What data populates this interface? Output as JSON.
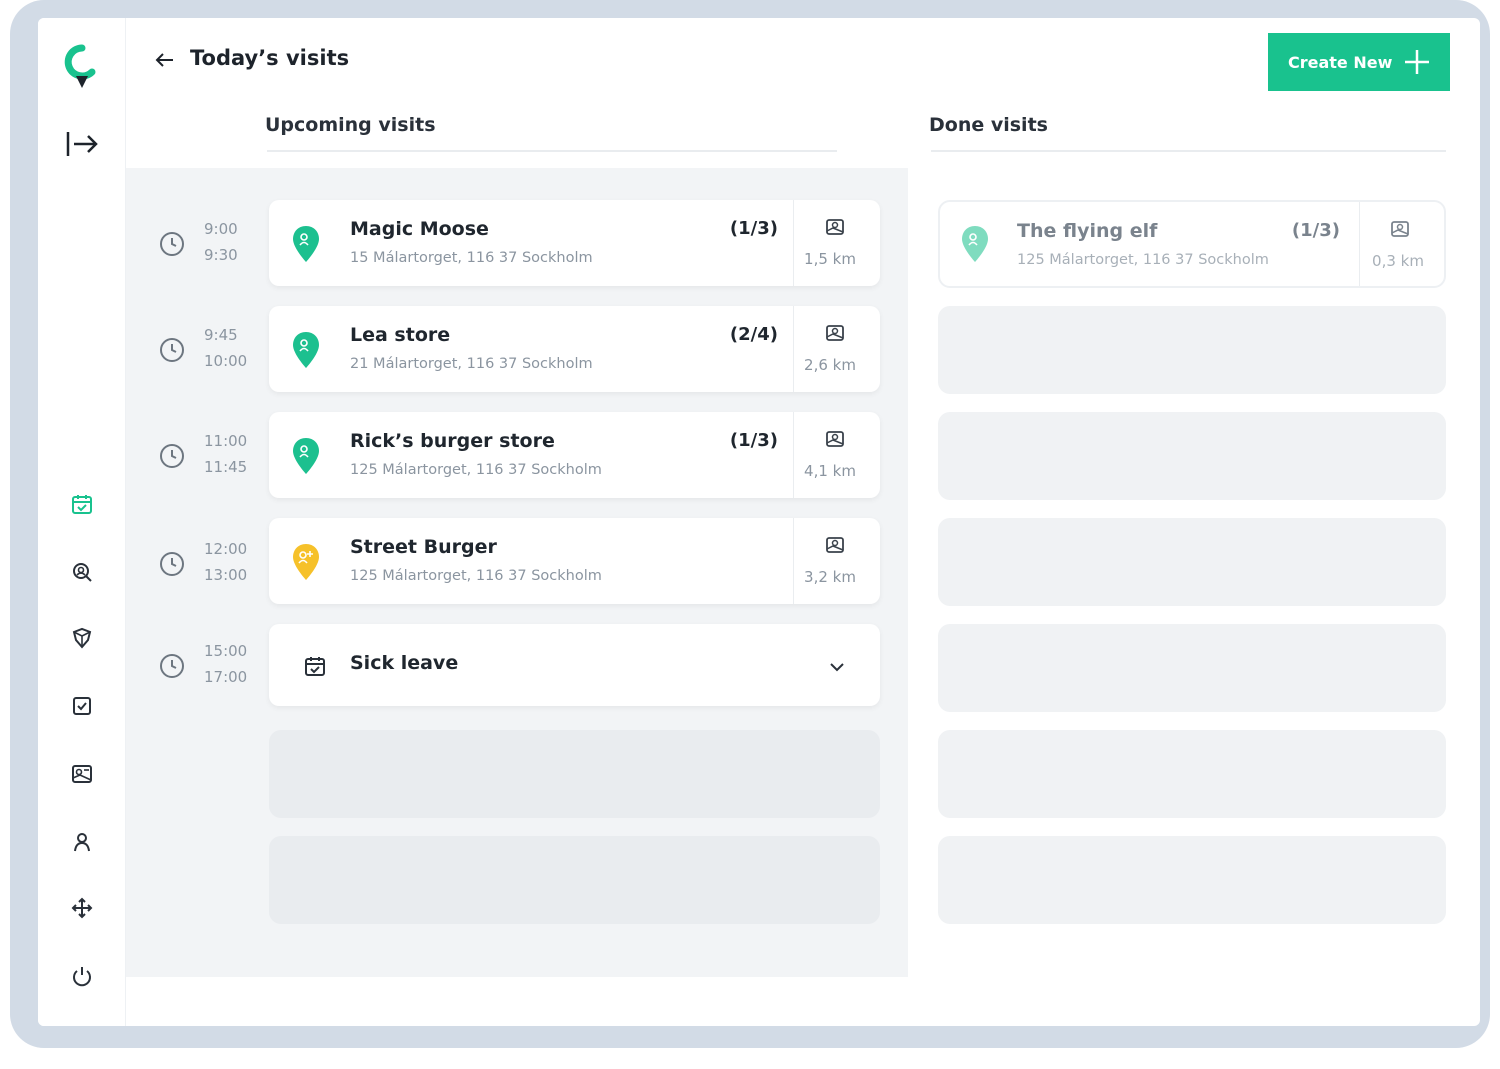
{
  "header": {
    "title": "Today’s visits",
    "create_label": "Create New"
  },
  "columns": {
    "upcoming_title": "Upcoming visits",
    "done_title": "Done visits"
  },
  "upcoming": [
    {
      "start": "9:00",
      "end": "9:30",
      "name": "Magic Moose",
      "address": "15 Málartorget, 116 37 Sockholm",
      "count": "(1/3)",
      "distance": "1,5 km",
      "pin_color": "#1cc08f"
    },
    {
      "start": "9:45",
      "end": "10:00",
      "name": "Lea store",
      "address": "21 Málartorget, 116 37 Sockholm",
      "count": "(2/4)",
      "distance": "2,6 km",
      "pin_color": "#1cc08f"
    },
    {
      "start": "11:00",
      "end": "11:45",
      "name": "Rick’s burger store",
      "address": "125 Málartorget, 116 37 Sockholm",
      "count": "(1/3)",
      "distance": "4,1 km",
      "pin_color": "#1cc08f"
    },
    {
      "start": "12:00",
      "end": "13:00",
      "name": "Street Burger",
      "address": "125 Málartorget, 116 37 Sockholm",
      "count": "",
      "distance": "3,2 km",
      "pin_color": "#f6c12a"
    }
  ],
  "sick_leave": {
    "start": "15:00",
    "end": "17:00",
    "label": "Sick leave"
  },
  "done": [
    {
      "name": "The flying elf",
      "address": "125 Málartorget, 116 37 Sockholm",
      "count": "(1/3)",
      "distance": "0,3 km",
      "pin_color": "#7fdcbf"
    }
  ],
  "colors": {
    "accent": "#19c28e",
    "frame": "#d2dbe6",
    "panel": "#f2f4f6"
  },
  "sidebar_icons": [
    "logo-icon",
    "expand-icon",
    "calendar-icon",
    "search-icon",
    "shapes-icon",
    "checkbox-icon",
    "map-icon",
    "person-icon",
    "move-icon",
    "power-icon"
  ]
}
